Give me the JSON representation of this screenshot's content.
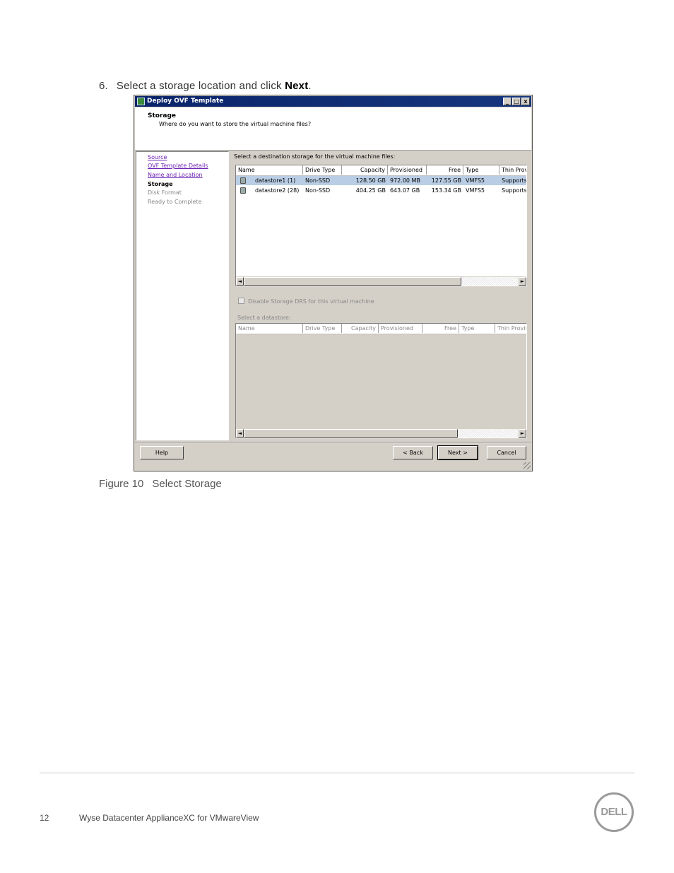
{
  "step": {
    "number": "6.",
    "text": "Select a storage location and click ",
    "bold": "Next",
    "end": "."
  },
  "caption": {
    "figure": "Figure 10",
    "title": "Select Storage"
  },
  "dialog": {
    "title": "Deploy OVF Template",
    "window_buttons": {
      "minimize": "_",
      "maximize": "□",
      "close": "x"
    },
    "header_title": "Storage",
    "header_subtitle": "Where do you want to store the virtual machine files?",
    "steps": [
      {
        "label": "Source",
        "state": "link"
      },
      {
        "label": "OVF Template Details",
        "state": "link"
      },
      {
        "label": "Name and Location",
        "state": "link"
      },
      {
        "label": "Storage",
        "state": "current"
      },
      {
        "label": "Disk Format",
        "state": "disabled"
      },
      {
        "label": "Ready to Complete",
        "state": "disabled"
      }
    ],
    "main_label": "Select a destination storage for the virtual machine files:",
    "columns": [
      "Name",
      "Drive Type",
      "Capacity",
      "Provisioned",
      "Free",
      "Type",
      "Thin Prov"
    ],
    "rows": [
      {
        "name": "datastore1 (1)",
        "drive_type": "Non-SSD",
        "capacity": "128.50 GB",
        "provisioned": "972.00 MB",
        "free": "127.55 GB",
        "type": "VMFS5",
        "thin": "Supports",
        "selected": true
      },
      {
        "name": "datastore2 (28)",
        "drive_type": "Non-SSD",
        "capacity": "404.25 GB",
        "provisioned": "643.07 GB",
        "free": "153.34 GB",
        "type": "VMFS5",
        "thin": "Supports",
        "selected": false
      }
    ],
    "checkbox_label": "Disable Storage DRS for this virtual machine",
    "select_datastore_label": "Select a datastore:",
    "lower_columns": [
      "Name",
      "Drive Type",
      "Capacity",
      "Provisioned",
      "Free",
      "Type",
      "Thin Provis"
    ],
    "scroll": {
      "left": "◄",
      "right": "►"
    },
    "buttons": {
      "help": "Help",
      "back": "< Back",
      "next": "Next >",
      "cancel": "Cancel"
    }
  },
  "footer": {
    "page_number": "12",
    "doc_title": "Wyse Datacenter ApplianceXC for VMwareView",
    "logo": "DELL"
  }
}
